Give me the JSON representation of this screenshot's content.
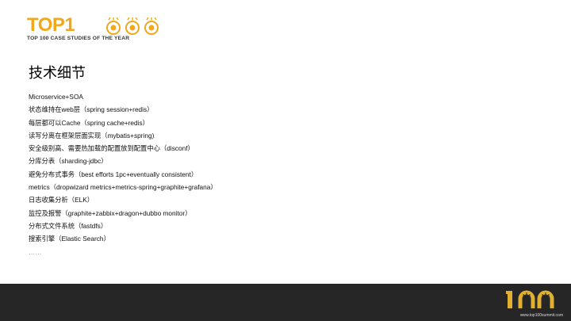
{
  "header": {
    "logo_text": "TOP1",
    "logo_subtitle": "TOP 100 CASE STUDIES OF THE YEAR"
  },
  "slide": {
    "title": "技术细节",
    "items": [
      "Microservice+SOA",
      "状态维持在web层（spring session+redis）",
      "每层都可以Cache（spring cache+redis）",
      "读写分离在框架层面实现（mybatis+spring)",
      "安全级别高、需要热加载的配置放到配置中心（disconf）",
      "分库分表（sharding-jdbc）",
      "避免分布式事务（best efforts 1pc+eventually consistent）",
      "metrics（dropwizard metrics+metrics-spring+graphite+grafana）",
      "日志收集分析（ELK）",
      "监控及报警（graphite+zabbix+dragon+dubbo monitor）",
      "分布式文件系统（fastdfs）",
      "搜索引擎（Elastic Search）",
      "……"
    ]
  },
  "footer": {
    "logo_text": "100",
    "url": "www.top100summit.com"
  },
  "colors": {
    "brand_gold": "#f0a81c",
    "footer_bg": "#262626"
  }
}
